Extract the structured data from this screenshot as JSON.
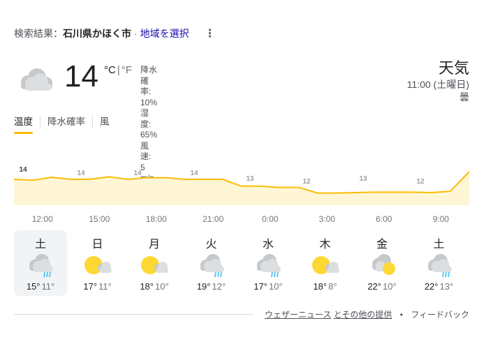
{
  "header": {
    "prefix": "検索結果：",
    "location": "石川県かほく市",
    "separator": "·",
    "choose_region": "地域を選択",
    "more_icon": "more-vert-icon"
  },
  "current": {
    "icon": "cloud-icon",
    "temperature": "14",
    "unit_c": "°C",
    "unit_sep": "|",
    "unit_f": "°F",
    "precip": "降水確率: 10%",
    "humidity": "湿度: 65%",
    "wind": "風速: 5 m/s"
  },
  "summary": {
    "title": "天気",
    "time": "11:00 (土曜日)",
    "condition": "曇"
  },
  "tabs": [
    {
      "label": "温度",
      "active": true
    },
    {
      "label": "降水確率",
      "active": false
    },
    {
      "label": "風",
      "active": false
    }
  ],
  "chart_data": {
    "type": "area",
    "series": [
      {
        "values": [
          14,
          14,
          14,
          14,
          14,
          14,
          14,
          14,
          14,
          14,
          14,
          14,
          13,
          13,
          13,
          13,
          12,
          12,
          12,
          12,
          12,
          12,
          12,
          12,
          14
        ]
      }
    ],
    "labels": [
      "14",
      "14",
      "14",
      "14",
      "13",
      "12",
      "13",
      "12"
    ],
    "color": "#fbbc04",
    "fill": "#fef6d4"
  },
  "hours": [
    "12:00",
    "15:00",
    "18:00",
    "21:00",
    "0:00",
    "3:00",
    "6:00",
    "9:00"
  ],
  "days": [
    {
      "name": "土",
      "icon": "rain-cloud-icon",
      "high": "15°",
      "low": "11°",
      "selected": true
    },
    {
      "name": "日",
      "icon": "partly-sunny-icon",
      "high": "17°",
      "low": "11°",
      "selected": false
    },
    {
      "name": "月",
      "icon": "partly-sunny-icon",
      "high": "18°",
      "low": "10°",
      "selected": false
    },
    {
      "name": "火",
      "icon": "rain-cloud-icon",
      "high": "19°",
      "low": "12°",
      "selected": false
    },
    {
      "name": "水",
      "icon": "rain-cloud-icon",
      "high": "17°",
      "low": "10°",
      "selected": false
    },
    {
      "name": "木",
      "icon": "partly-sunny-icon",
      "high": "18°",
      "low": "8°",
      "selected": false
    },
    {
      "name": "金",
      "icon": "cloud-sun-icon",
      "high": "22°",
      "low": "10°",
      "selected": false
    },
    {
      "name": "土",
      "icon": "rain-cloud-icon",
      "high": "22°",
      "low": "13°",
      "selected": false
    }
  ],
  "footer": {
    "weather_news": "ウェザーニュース",
    "other_providers": "とその他の提供",
    "dot": "•",
    "feedback": "フィードバック"
  }
}
